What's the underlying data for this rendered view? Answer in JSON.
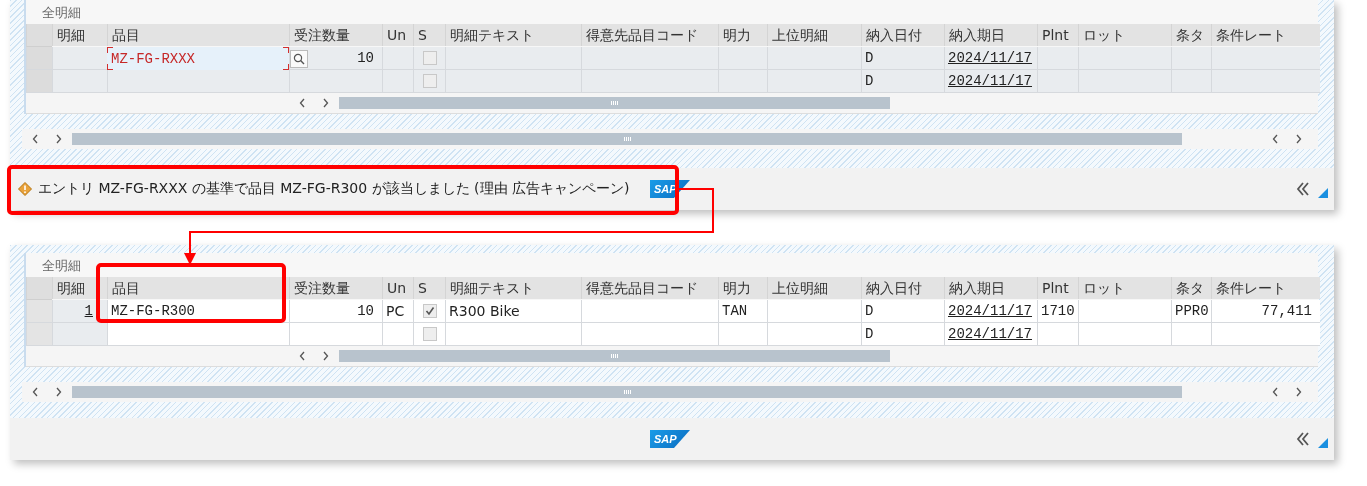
{
  "panels": [
    {
      "section_title": "全明細",
      "columns": [
        {
          "label": "明細",
          "kind": "link_right"
        },
        {
          "label": "品目",
          "kind": "mono"
        },
        {
          "label": "受注数量",
          "kind": "mono_right"
        },
        {
          "label": "Un",
          "kind": "text"
        },
        {
          "label": "S",
          "kind": "checkbox"
        },
        {
          "label": "明細テキスト",
          "kind": "text"
        },
        {
          "label": "得意先品目コード",
          "kind": "text"
        },
        {
          "label": "明力",
          "kind": "mono"
        },
        {
          "label": "上位明細",
          "kind": "text"
        },
        {
          "label": "納入日付",
          "kind": "mono"
        },
        {
          "label": "納入期日",
          "kind": "date"
        },
        {
          "label": "Plnt",
          "kind": "mono"
        },
        {
          "label": "ロット",
          "kind": "text"
        },
        {
          "label": "条タ",
          "kind": "mono"
        },
        {
          "label": "条件レート",
          "kind": "mono_right"
        }
      ],
      "rows": [
        {
          "editable": false,
          "input_error": true,
          "cells": [
            null,
            "MZ-FG-RXXX",
            "10",
            null,
            {
              "checked": false
            },
            null,
            null,
            null,
            null,
            "D",
            "2024/11/17",
            null,
            null,
            null,
            null
          ]
        },
        {
          "editable": false,
          "input_error": false,
          "cells": [
            null,
            null,
            null,
            null,
            {
              "checked": false
            },
            null,
            null,
            null,
            null,
            "D",
            "2024/11/17",
            null,
            null,
            null,
            null
          ]
        }
      ],
      "status_message": "エントリ MZ-FG-RXXX の基準で品目 MZ-FG-R300 が該当しました (理由 広告キャンペーン)",
      "logo": "SAP"
    },
    {
      "section_title": "全明細",
      "columns": [
        {
          "label": "明細",
          "kind": "link_right"
        },
        {
          "label": "品目",
          "kind": "mono"
        },
        {
          "label": "受注数量",
          "kind": "mono_right"
        },
        {
          "label": "Un",
          "kind": "text"
        },
        {
          "label": "S",
          "kind": "checkbox"
        },
        {
          "label": "明細テキスト",
          "kind": "text"
        },
        {
          "label": "得意先品目コード",
          "kind": "text"
        },
        {
          "label": "明力",
          "kind": "mono"
        },
        {
          "label": "上位明細",
          "kind": "text"
        },
        {
          "label": "納入日付",
          "kind": "mono"
        },
        {
          "label": "納入期日",
          "kind": "date"
        },
        {
          "label": "Plnt",
          "kind": "mono"
        },
        {
          "label": "ロット",
          "kind": "text"
        },
        {
          "label": "条タ",
          "kind": "mono"
        },
        {
          "label": "条件レート",
          "kind": "mono_right"
        }
      ],
      "rows": [
        {
          "editable": true,
          "input_error": false,
          "cells": [
            "1",
            "MZ-FG-R300",
            "10",
            "PC",
            {
              "checked": true
            },
            "R300 Bike",
            null,
            "TAN",
            null,
            "D",
            "2024/11/17",
            "1710",
            null,
            "PPR0",
            "77,411"
          ]
        },
        {
          "editable": true,
          "input_error": false,
          "cells": [
            null,
            null,
            null,
            null,
            {
              "checked": false
            },
            null,
            null,
            null,
            null,
            "D",
            "2024/11/17",
            null,
            null,
            null,
            null
          ]
        }
      ],
      "logo": "SAP"
    }
  ]
}
